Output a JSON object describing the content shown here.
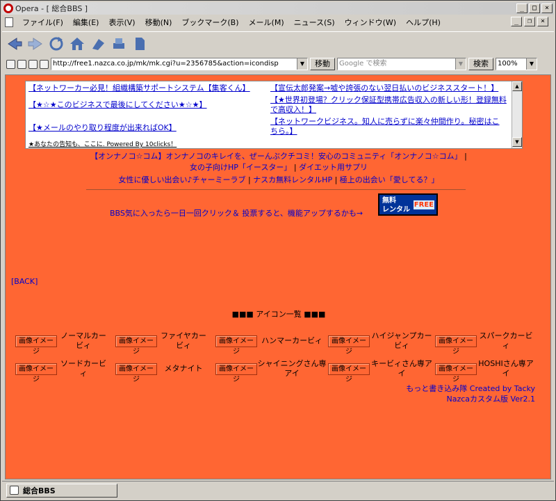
{
  "window": {
    "title": "Opera - [ 総合BBS ]"
  },
  "menu": [
    "ファイル(F)",
    "編集(E)",
    "表示(V)",
    "移動(N)",
    "ブックマーク(B)",
    "メール(M)",
    "ニュース(S)",
    "ウィンドウ(W)",
    "ヘルプ(H)"
  ],
  "address": {
    "url": "http://free1.nazca.co.jp/mk/mk.cgi?u=2356785&action=icondisp",
    "go_label": "移動",
    "search_placeholder": "Google で検索",
    "search_label": "検索",
    "zoom": "100%"
  },
  "ads": {
    "left1": "【ネットワーカー必見！組織構築サポートシステム【集客くん】",
    "left2": "【★☆★このビジネスで最後にしてください★☆★】",
    "left3": "【★メールのやり取り程度が出来ればOK】",
    "left4": "★あなたの告知も、ここに. Powered By 10clicks！",
    "right1": "【宣伝太郎発案→嘘や誇張のない翌日払いのビジネススタート！】",
    "right2": "【★世界初登場？クリック保証型携帯広告収入の新しい形！登録無料で高収入！】",
    "right3": "【ネットワークビジネス。知人に売らずに楽々仲間作り。秘密はこちら。】"
  },
  "links": {
    "line1": "【オンナノコ☆コム】オンナノコのキレイを、ぜーんぶクチコミ！安心のコミュニティ「オンナノコ☆コム」",
    "line2a": "女の子向けHP「イースター」",
    "line2b": "ダイエット用サプリ",
    "line3a": "女性に優しい出会い♪チャーミーラブ",
    "line3b": "ナスカ無料レンタルHP",
    "line3c": "極上の出会い「愛してる？」"
  },
  "vote_text": "BBS気に入ったら一日一回クリック＆ 投票すると、機能アップするかも→",
  "rental": {
    "line1": "無料",
    "line2": "レンタル",
    "free": "FREE"
  },
  "back": "[BACK]",
  "icon_title": "■■■ アイコン一覧 ■■■",
  "image_btn": "画像イメージ",
  "icons_row1": [
    "ノーマルカービィ",
    "ファイヤカービィ",
    "ハンマーカービィ",
    "ハイジャンプカービィ",
    "スパークカービィ"
  ],
  "icons_row2": [
    "ソードカービィ",
    "メタナイト",
    "シャイニングさん専アイ",
    "キービィさん専アイ",
    "HOSHIさん専アイ"
  ],
  "credits": {
    "line1": "もっと書き込み隊 Created by Tacky",
    "line2": "Nazcaカスタム版 Ver2.1"
  },
  "status": {
    "tab": "総合BBS"
  }
}
